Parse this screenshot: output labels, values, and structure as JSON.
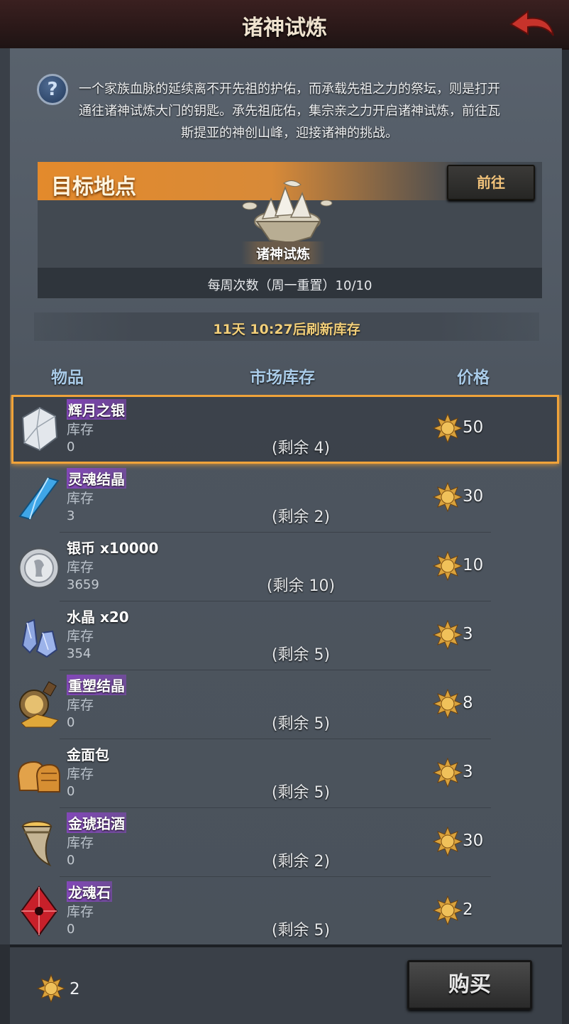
{
  "header": {
    "title": "诸神试炼"
  },
  "description": "一个家族血脉的延续离不开先祖的护佑，而承载先祖之力的祭坛，则是打开通往诸神试炼大门的钥匙。承先祖庇佑，集宗亲之力开启诸神试炼，前往瓦斯提亚的神创山峰，迎接诸神的挑战。",
  "target": {
    "label": "目标地点",
    "goto_label": "前往",
    "location_name": "诸神试炼",
    "weekly_count": "每周次数（周一重置）10/10"
  },
  "refresh_text": "11天 10:27后刷新库存",
  "columns": {
    "item": "物品",
    "stock": "市场库存",
    "price": "价格"
  },
  "items": [
    {
      "name": "辉月之银",
      "stock_label": "库存",
      "stock": "0",
      "remaining": "(剩余 4)",
      "price": "50",
      "name_style": "purple",
      "icon": "silver-ore-icon"
    },
    {
      "name": "灵魂结晶",
      "stock_label": "库存",
      "stock": "3",
      "remaining": "(剩余 2)",
      "price": "30",
      "name_style": "purple",
      "icon": "soul-crystal-icon"
    },
    {
      "name": "银币 x10000",
      "stock_label": "库存",
      "stock": "3659",
      "remaining": "(剩余 10)",
      "price": "10",
      "name_style": "plain",
      "icon": "silver-coin-icon"
    },
    {
      "name": "水晶 x20",
      "stock_label": "库存",
      "stock": "354",
      "remaining": "(剩余 5)",
      "price": "3",
      "name_style": "plain",
      "icon": "crystal-icon"
    },
    {
      "name": "重塑结晶",
      "stock_label": "库存",
      "stock": "0",
      "remaining": "(剩余 5)",
      "price": "8",
      "name_style": "purple",
      "icon": "potion-icon"
    },
    {
      "name": "金面包",
      "stock_label": "库存",
      "stock": "0",
      "remaining": "(剩余 5)",
      "price": "3",
      "name_style": "orange",
      "icon": "bread-icon"
    },
    {
      "name": "金琥珀酒",
      "stock_label": "库存",
      "stock": "0",
      "remaining": "(剩余 2)",
      "price": "30",
      "name_style": "purple",
      "icon": "horn-cup-icon"
    },
    {
      "name": "龙魂石",
      "stock_label": "库存",
      "stock": "0",
      "remaining": "(剩余 5)",
      "price": "2",
      "name_style": "purple",
      "icon": "dragon-stone-icon"
    }
  ],
  "footer": {
    "currency": "2",
    "buy_label": "购买"
  },
  "colors": {
    "accent_orange": "#e38a2c",
    "selection_border": "#f0a33a",
    "header_bg": "#2a1818",
    "currency_gold": "#d9a23c"
  }
}
